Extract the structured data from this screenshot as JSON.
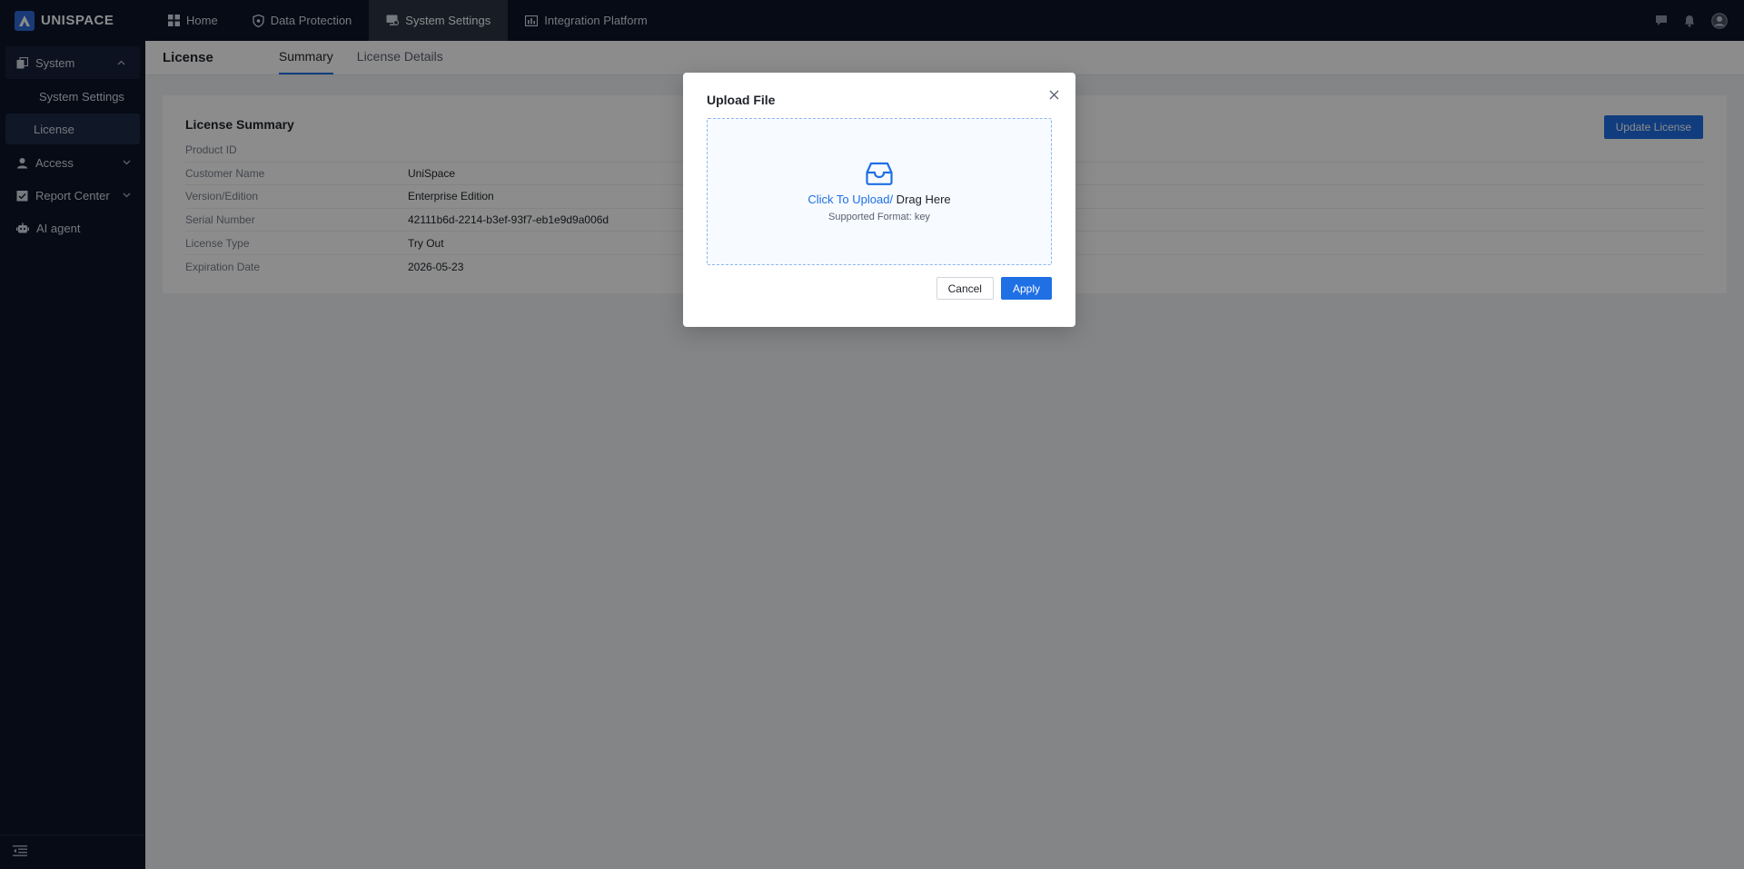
{
  "brand": {
    "name": "UNISPACE",
    "logo_icon": "unispace-logo-icon",
    "accent": "#2f6bd9"
  },
  "topnav": {
    "items": [
      {
        "label": "Home",
        "icon": "grid-icon"
      },
      {
        "label": "Data Protection",
        "icon": "shield-icon"
      },
      {
        "label": "System Settings",
        "icon": "monitor-gear-icon",
        "active": true
      },
      {
        "label": "Integration Platform",
        "icon": "chart-icon"
      }
    ],
    "right_icons": [
      "chat-icon",
      "bell-icon",
      "user-avatar-icon"
    ]
  },
  "sidebar": {
    "groups": [
      {
        "label": "System",
        "icon": "system-icon",
        "expanded": true,
        "children": [
          {
            "label": "System Settings"
          },
          {
            "label": "License",
            "active": true
          }
        ]
      },
      {
        "label": "Access",
        "icon": "user-icon",
        "expanded": false
      },
      {
        "label": "Report Center",
        "icon": "report-icon",
        "expanded": false
      },
      {
        "label": "AI agent",
        "icon": "robot-icon"
      }
    ],
    "collapse_icon": "collapse-menu-icon"
  },
  "page": {
    "title": "License",
    "tabs": [
      {
        "label": "Summary",
        "active": true
      },
      {
        "label": "License Details"
      }
    ]
  },
  "summary": {
    "title": "License Summary",
    "update_button": "Update License",
    "rows": [
      {
        "key": "Product ID",
        "value": ""
      },
      {
        "key": "Customer Name",
        "value": "UniSpace"
      },
      {
        "key": "Version/Edition",
        "value": "Enterprise Edition"
      },
      {
        "key": "Serial Number",
        "value": "42111b6d-2214-b3ef-93f7-eb1e9d9a006d"
      },
      {
        "key": "License Type",
        "value": "Try Out"
      },
      {
        "key": "Expiration Date",
        "value": "2026-05-23"
      }
    ]
  },
  "modal": {
    "title": "Upload File",
    "close_icon": "close-icon",
    "dropzone_icon": "inbox-icon",
    "upload_link": "Click To Upload/",
    "upload_rest": " Drag Here",
    "format_hint": "Supported Format: key",
    "cancel_label": "Cancel",
    "apply_label": "Apply"
  },
  "colors": {
    "primary": "#1f6fe5",
    "nav_bg": "#0b1428",
    "overlay": "rgba(0,0,0,0.45)"
  }
}
